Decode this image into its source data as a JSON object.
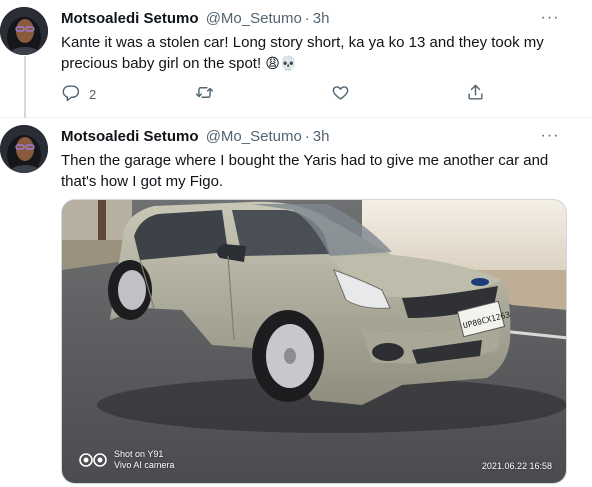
{
  "tweets": [
    {
      "name": "Motsoaledi Setumo",
      "handle": "@Mo_Setumo",
      "separator": "·",
      "time": "3h",
      "more": "···",
      "text": "Kante it was a stolen car! Long story short, ka ya ko 13 and they took my precious baby girl on the spot! ",
      "emojis": "😩💀",
      "reply_count": "2"
    },
    {
      "name": "Motsoaledi Setumo",
      "handle": "@Mo_Setumo",
      "separator": "·",
      "time": "3h",
      "more": "···",
      "text": "Then the garage where I bought the Yaris had to give me another car and that's how I got my Figo.",
      "media": {
        "watermark_line1": "Shot on Y91",
        "watermark_line2": "Vivo AI camera",
        "datestamp": "2021.06.22 16:58",
        "plate": "UP80CX1263"
      }
    }
  ],
  "icons": {
    "reply": "reply-icon",
    "retweet": "retweet-icon",
    "like": "heart-icon",
    "share": "share-icon",
    "more": "more-icon"
  },
  "colors": {
    "text_primary": "#0f1419",
    "text_secondary": "#536471",
    "thread_line": "#cfd9de"
  }
}
